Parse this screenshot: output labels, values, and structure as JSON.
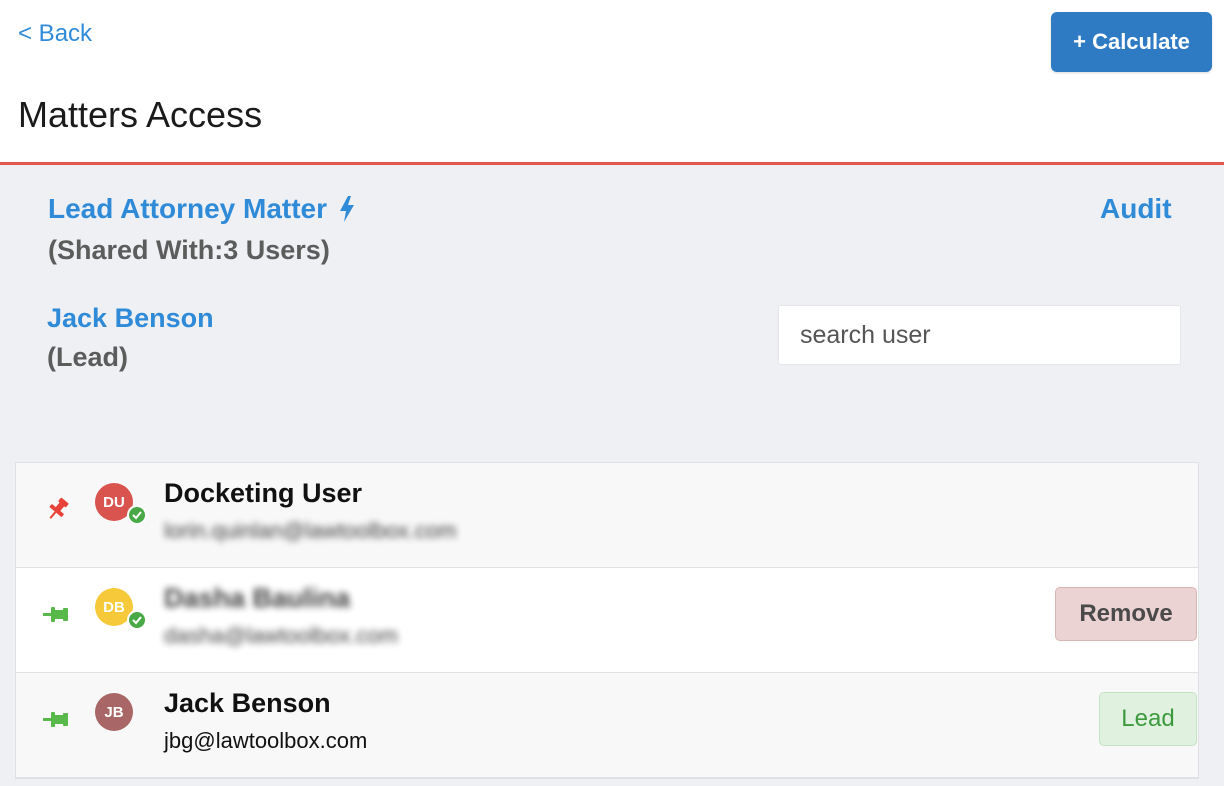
{
  "header": {
    "back_label": "< Back",
    "calculate_label": "+ Calculate",
    "title": "Matters Access"
  },
  "matter": {
    "title": "Lead Attorney Matter",
    "shared_with": "(Shared With:3 Users)",
    "audit_label": "Audit",
    "lead_name": "Jack Benson",
    "lead_role": "(Lead)"
  },
  "search": {
    "placeholder": "search user",
    "value": ""
  },
  "users": [
    {
      "initials": "DU",
      "name": "Docketing User",
      "email": "lorin.quinlan@lawtoolbox.com",
      "avatar_color": "#d9534f",
      "pin_icon": "pushpin-icon",
      "pin_color": "#e8433a",
      "online": true
    },
    {
      "initials": "DB",
      "name": "Dasha Baulina",
      "email": "dasha@lawtoolbox.com",
      "avatar_color": "#f5c93a",
      "pin_icon": "pin-icon",
      "pin_color": "#58b94a",
      "online": true,
      "action_label": "Remove"
    },
    {
      "initials": "JB",
      "name": "Jack Benson",
      "email": "jbg@lawtoolbox.com",
      "avatar_color": "#a96666",
      "pin_icon": "pin-icon",
      "pin_color": "#58b94a",
      "online": false,
      "badge_label": "Lead"
    }
  ],
  "colors": {
    "accent": "#2f8bd8",
    "primary_button": "#2e7bc4",
    "header_border": "#e2584d",
    "panel_bg": "#eef0f4"
  }
}
